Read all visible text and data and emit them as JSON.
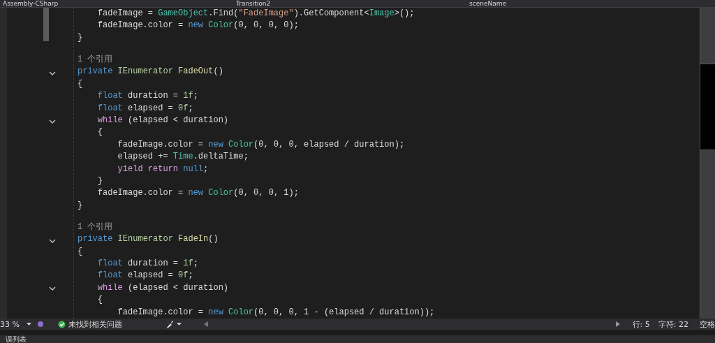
{
  "tabs": [
    {
      "label": "Assembly-CSharp"
    },
    {
      "label": "Transition2"
    },
    {
      "label": "sceneName"
    }
  ],
  "code_lines": [
    {
      "kind": "code",
      "tokens": [
        {
          "kind": "plain",
          "t": "    fadeImage = "
        },
        {
          "kind": "type",
          "t": "GameObject"
        },
        {
          "kind": "plain",
          "t": ".Find("
        },
        {
          "kind": "string",
          "t": "\"FadeImage\""
        },
        {
          "kind": "plain",
          "t": ").GetComponent<"
        },
        {
          "kind": "type",
          "t": "Image"
        },
        {
          "kind": "plain",
          "t": ">();"
        }
      ]
    },
    {
      "kind": "code",
      "tokens": [
        {
          "kind": "plain",
          "t": "    fadeImage.color = "
        },
        {
          "kind": "keyword",
          "t": "new"
        },
        {
          "kind": "type",
          "t": " Color"
        },
        {
          "kind": "plain",
          "t": "(0, 0, 0, 0);"
        }
      ]
    },
    {
      "kind": "code",
      "tokens": [
        {
          "kind": "plain",
          "t": "}"
        }
      ]
    },
    {
      "kind": "blank"
    },
    {
      "kind": "codelens",
      "text": "1 个引用"
    },
    {
      "kind": "code",
      "collapsible": true,
      "tokens": [
        {
          "kind": "keyword",
          "t": "private"
        },
        {
          "kind": "interface",
          "t": " IEnumerator"
        },
        {
          "kind": "method",
          "t": " FadeOut"
        },
        {
          "kind": "plain",
          "t": "()"
        }
      ]
    },
    {
      "kind": "code",
      "tokens": [
        {
          "kind": "plain",
          "t": "{"
        }
      ]
    },
    {
      "kind": "code",
      "tokens": [
        {
          "kind": "keyword",
          "t": "    float"
        },
        {
          "kind": "plain",
          "t": " duration = "
        },
        {
          "kind": "number",
          "t": "1f"
        },
        {
          "kind": "plain",
          "t": ";"
        }
      ]
    },
    {
      "kind": "code",
      "tokens": [
        {
          "kind": "keyword",
          "t": "    float"
        },
        {
          "kind": "plain",
          "t": " elapsed = "
        },
        {
          "kind": "number",
          "t": "0f"
        },
        {
          "kind": "plain",
          "t": ";"
        }
      ]
    },
    {
      "kind": "code",
      "collapsible": true,
      "tokens": [
        {
          "kind": "control",
          "t": "    while"
        },
        {
          "kind": "plain",
          "t": " (elapsed < duration)"
        }
      ]
    },
    {
      "kind": "code",
      "tokens": [
        {
          "kind": "plain",
          "t": "    {"
        }
      ]
    },
    {
      "kind": "code",
      "tokens": [
        {
          "kind": "plain",
          "t": "        fadeImage.color = "
        },
        {
          "kind": "keyword",
          "t": "new"
        },
        {
          "kind": "type",
          "t": " Color"
        },
        {
          "kind": "plain",
          "t": "(0, 0, 0, elapsed / duration);"
        }
      ]
    },
    {
      "kind": "code",
      "tokens": [
        {
          "kind": "plain",
          "t": "        elapsed += "
        },
        {
          "kind": "type",
          "t": "Time"
        },
        {
          "kind": "plain",
          "t": ".deltaTime;"
        }
      ]
    },
    {
      "kind": "code",
      "tokens": [
        {
          "kind": "control",
          "t": "        yield return"
        },
        {
          "kind": "keyword",
          "t": " null"
        },
        {
          "kind": "plain",
          "t": ";"
        }
      ]
    },
    {
      "kind": "code",
      "tokens": [
        {
          "kind": "plain",
          "t": "    }"
        }
      ]
    },
    {
      "kind": "code",
      "tokens": [
        {
          "kind": "plain",
          "t": "    fadeImage.color = "
        },
        {
          "kind": "keyword",
          "t": "new"
        },
        {
          "kind": "type",
          "t": " Color"
        },
        {
          "kind": "plain",
          "t": "(0, 0, 0, 1);"
        }
      ]
    },
    {
      "kind": "code",
      "tokens": [
        {
          "kind": "plain",
          "t": "}"
        }
      ]
    },
    {
      "kind": "blank"
    },
    {
      "kind": "codelens",
      "text": "1 个引用"
    },
    {
      "kind": "code",
      "collapsible": true,
      "tokens": [
        {
          "kind": "keyword",
          "t": "private"
        },
        {
          "kind": "interface",
          "t": " IEnumerator"
        },
        {
          "kind": "method",
          "t": " FadeIn"
        },
        {
          "kind": "plain",
          "t": "()"
        }
      ]
    },
    {
      "kind": "code",
      "tokens": [
        {
          "kind": "plain",
          "t": "{"
        }
      ]
    },
    {
      "kind": "code",
      "tokens": [
        {
          "kind": "keyword",
          "t": "    float"
        },
        {
          "kind": "plain",
          "t": " duration = "
        },
        {
          "kind": "number",
          "t": "1f"
        },
        {
          "kind": "plain",
          "t": ";"
        }
      ]
    },
    {
      "kind": "code",
      "tokens": [
        {
          "kind": "keyword",
          "t": "    float"
        },
        {
          "kind": "plain",
          "t": " elapsed = "
        },
        {
          "kind": "number",
          "t": "0f"
        },
        {
          "kind": "plain",
          "t": ";"
        }
      ]
    },
    {
      "kind": "code",
      "collapsible": true,
      "tokens": [
        {
          "kind": "control",
          "t": "    while"
        },
        {
          "kind": "plain",
          "t": " (elapsed < duration)"
        }
      ]
    },
    {
      "kind": "code",
      "tokens": [
        {
          "kind": "plain",
          "t": "    {"
        }
      ]
    },
    {
      "kind": "code",
      "tokens": [
        {
          "kind": "plain",
          "t": "        fadeImage.color = "
        },
        {
          "kind": "keyword",
          "t": "new"
        },
        {
          "kind": "type",
          "t": " Color"
        },
        {
          "kind": "plain",
          "t": "(0, 0, 0, 1 - (elapsed / duration));"
        }
      ]
    }
  ],
  "status_bar": {
    "zoom": "33 %",
    "issues": "未找到相关问题",
    "line": "行: 5",
    "char": "字符: 22",
    "spaces": "空格"
  },
  "bottom_panel": {
    "title": "误列表"
  }
}
